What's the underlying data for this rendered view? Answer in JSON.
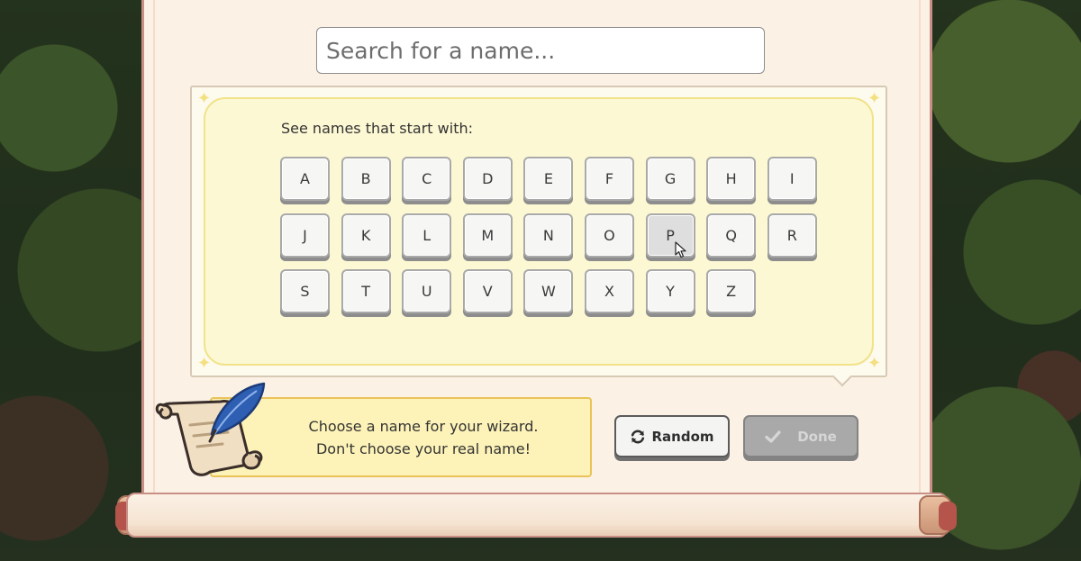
{
  "search": {
    "placeholder": "Search for a name..."
  },
  "letter_board": {
    "label": "See names that start with:",
    "letters": [
      "A",
      "B",
      "C",
      "D",
      "E",
      "F",
      "G",
      "H",
      "I",
      "J",
      "K",
      "L",
      "M",
      "N",
      "O",
      "P",
      "Q",
      "R",
      "S",
      "T",
      "U",
      "V",
      "W",
      "X",
      "Y",
      "Z"
    ],
    "hovered_letter": "P"
  },
  "hint": {
    "line1": "Choose a name for your wizard.",
    "line2": "Don't choose your real name!"
  },
  "buttons": {
    "random_label": "Random",
    "done_label": "Done",
    "done_enabled": false
  },
  "colors": {
    "parchment": "#fbf1e5",
    "board_fill": "#fcf8d3",
    "hint_fill": "#fdf3b8",
    "hint_border": "#e9c35a",
    "done_disabled": "#a9a9a9",
    "quill_blue": "#2f5fb3"
  },
  "icons": {
    "random": "refresh-icon",
    "done": "check-icon",
    "hint": "scroll-quill-icon"
  }
}
